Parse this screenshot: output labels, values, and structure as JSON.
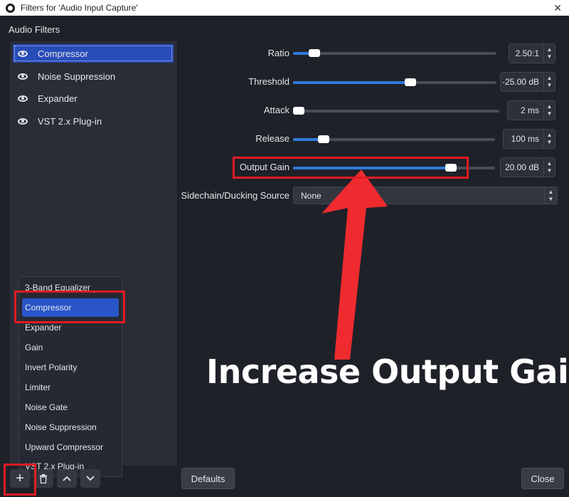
{
  "window": {
    "title": "Filters for 'Audio Input Capture'",
    "close_glyph": "✕"
  },
  "audio_filters": {
    "label": "Audio Filters",
    "items": [
      {
        "label": "Compressor",
        "selected": true
      },
      {
        "label": "Noise Suppression"
      },
      {
        "label": "Expander"
      },
      {
        "label": "VST 2.x Plug-in"
      }
    ]
  },
  "properties": {
    "ratio": {
      "label": "Ratio",
      "value": "2.50:1",
      "fraction": 0.08
    },
    "threshold": {
      "label": "Threshold",
      "value": "-25.00 dB",
      "fraction": 0.58
    },
    "attack": {
      "label": "Attack",
      "value": "2 ms",
      "fraction": 0.0
    },
    "release": {
      "label": "Release",
      "value": "100 ms",
      "fraction": 0.13
    },
    "output_gain": {
      "label": "Output Gain",
      "value": "20.00 dB",
      "fraction": 0.8
    },
    "sidechain": {
      "label": "Sidechain/Ducking Source",
      "value": "None"
    }
  },
  "add_menu": {
    "items": [
      {
        "label": "3-Band Equalizer"
      },
      {
        "label": "Compressor",
        "selected": true
      },
      {
        "label": "Expander"
      },
      {
        "label": "Gain"
      },
      {
        "label": "Invert Polarity"
      },
      {
        "label": "Limiter"
      },
      {
        "label": "Noise Gate"
      },
      {
        "label": "Noise Suppression"
      },
      {
        "label": "Upward Compressor"
      },
      {
        "label": "VST 2.x Plug-in"
      }
    ]
  },
  "toolbar": {
    "add_icon": "+",
    "remove_icon": "trash-icon",
    "up_icon": "^",
    "down_icon": "v"
  },
  "buttons": {
    "defaults": "Defaults",
    "close": "Close"
  },
  "annotation": {
    "text": "Increase Output Gain"
  },
  "colors": {
    "accent": "#2f7ad9",
    "highlight": "#e11b22",
    "arrow": "#ef2b2f"
  }
}
